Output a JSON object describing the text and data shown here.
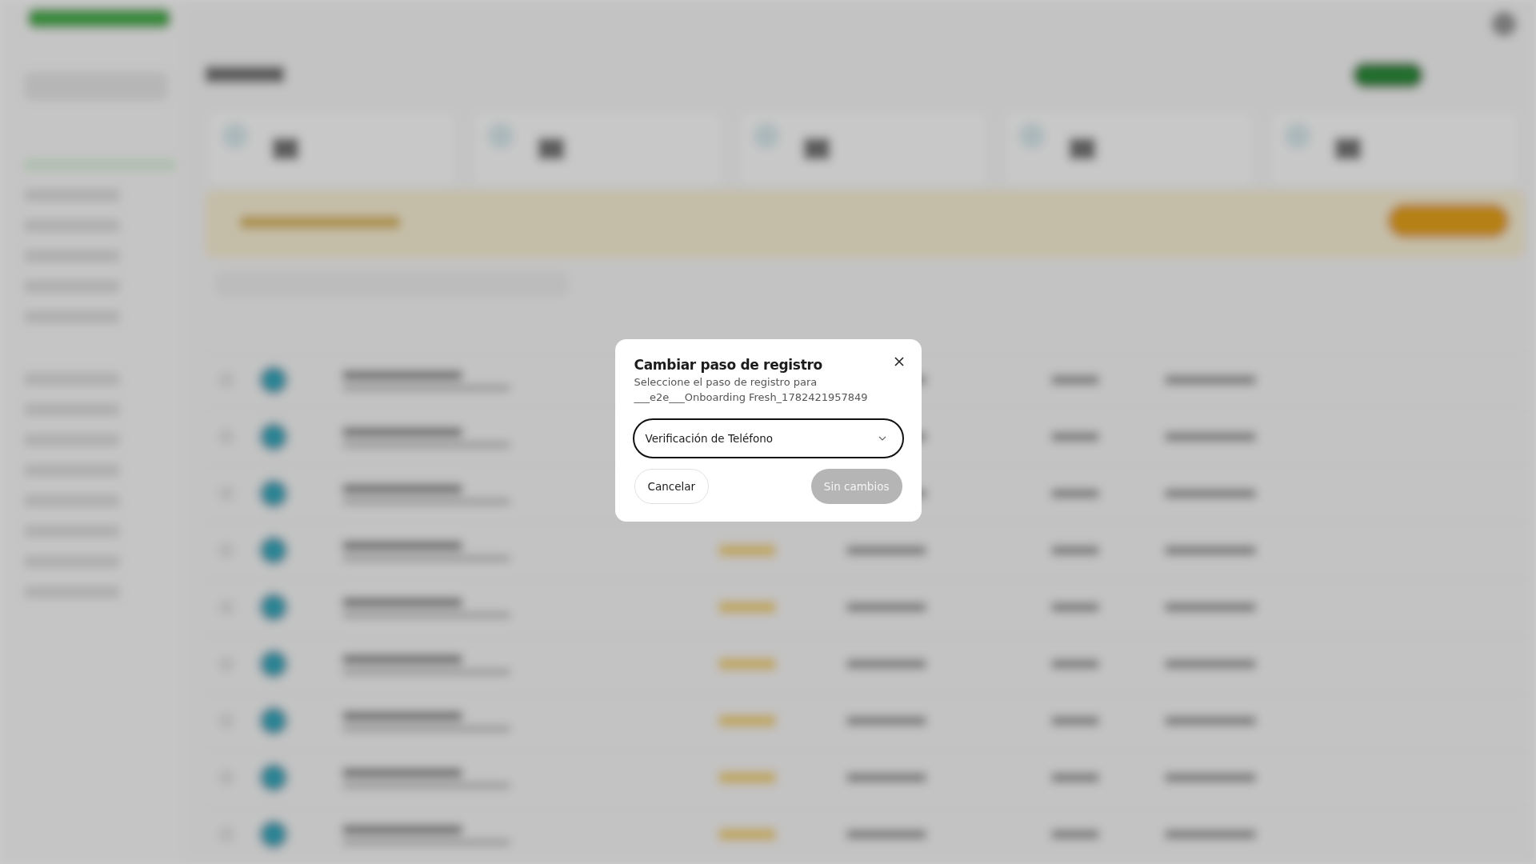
{
  "dialog": {
    "title": "Cambiar paso de registro",
    "description": "Seleccione el paso de registro para",
    "subject": "___e2e___Onboarding Fresh_1782421957849",
    "select": {
      "value": "Verificación de Teléfono"
    },
    "buttons": [
      {
        "label": "Cancelar",
        "kind": "secondary",
        "disabled": false
      },
      {
        "label": "Sin cambios",
        "kind": "primary",
        "disabled": true
      }
    ]
  }
}
